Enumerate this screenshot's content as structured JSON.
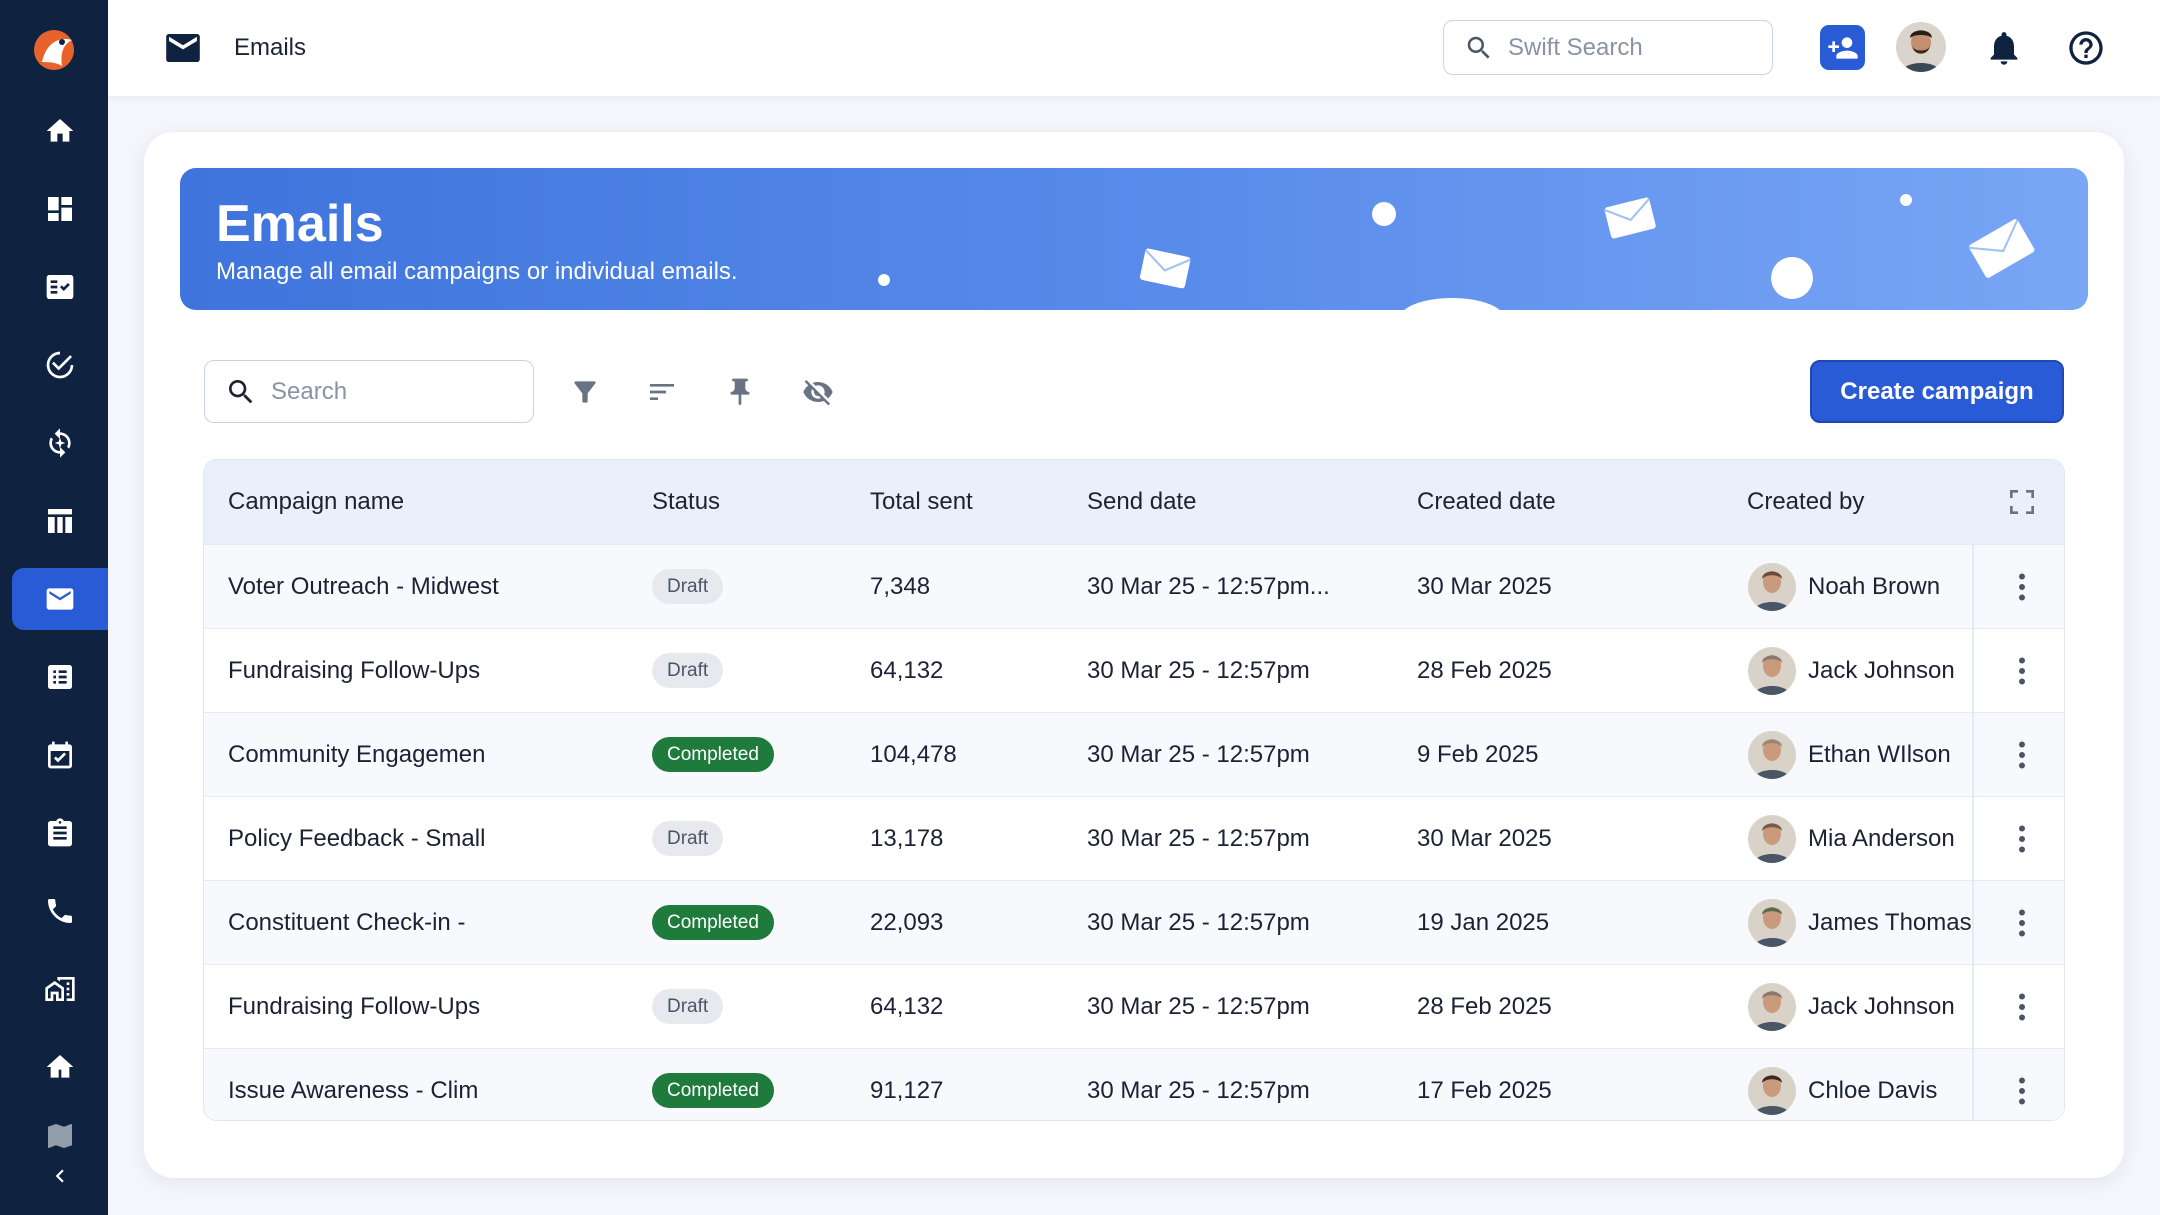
{
  "topbar": {
    "title": "Emails",
    "search_placeholder": "Swift Search"
  },
  "banner": {
    "title": "Emails",
    "subtitle": "Manage all email campaigns or individual emails."
  },
  "toolbar": {
    "search_placeholder": "Search",
    "create_label": "Create campaign"
  },
  "table": {
    "headers": [
      "Campaign name",
      "Status",
      "Total sent",
      "Send date",
      "Created date",
      "Created by"
    ],
    "rows": [
      {
        "name": "Voter Outreach - Midwest",
        "status": "Draft",
        "total": "7,348",
        "send": "30 Mar 25 - 12:57pm...",
        "created": "30 Mar 2025",
        "by": "Noah Brown",
        "avatar_color": "#6b4a3a"
      },
      {
        "name": "Fundraising Follow-Ups",
        "status": "Draft",
        "total": "64,132",
        "send": "30 Mar 25 - 12:57pm",
        "created": "28 Feb  2025",
        "by": "Jack Johnson",
        "avatar_color": "#8a7a6a"
      },
      {
        "name": "Community Engagemen",
        "status": "Completed",
        "total": "104,478",
        "send": "30 Mar 25 - 12:57pm",
        "created": "9 Feb 2025",
        "by": "Ethan WIlson",
        "avatar_color": "#9c8775"
      },
      {
        "name": "Policy Feedback - Small",
        "status": "Draft",
        "total": "13,178",
        "send": "30 Mar 25 - 12:57pm",
        "created": "30 Mar 2025",
        "by": "Mia Anderson",
        "avatar_color": "#7a5c4e"
      },
      {
        "name": "Constituent Check-in -",
        "status": "Completed",
        "total": "22,093",
        "send": "30 Mar 25 - 12:57pm",
        "created": "19 Jan 2025",
        "by": "James Thomas",
        "avatar_color": "#5d6a48"
      },
      {
        "name": "Fundraising Follow-Ups",
        "status": "Draft",
        "total": "64,132",
        "send": "30 Mar 25 - 12:57pm",
        "created": "28 Feb  2025",
        "by": "Jack Johnson",
        "avatar_color": "#8a7a6a"
      },
      {
        "name": "Issue Awareness - Clim",
        "status": "Completed",
        "total": "91,127",
        "send": "30 Mar 25 - 12:57pm",
        "created": "17 Feb 2025",
        "by": "Chloe Davis",
        "avatar_color": "#3a2a22"
      }
    ]
  },
  "colors": {
    "sidebar": "#0f2341",
    "accent": "#2a5bd7",
    "completed": "#1e7b3c",
    "draft": "#e7e9ee"
  }
}
